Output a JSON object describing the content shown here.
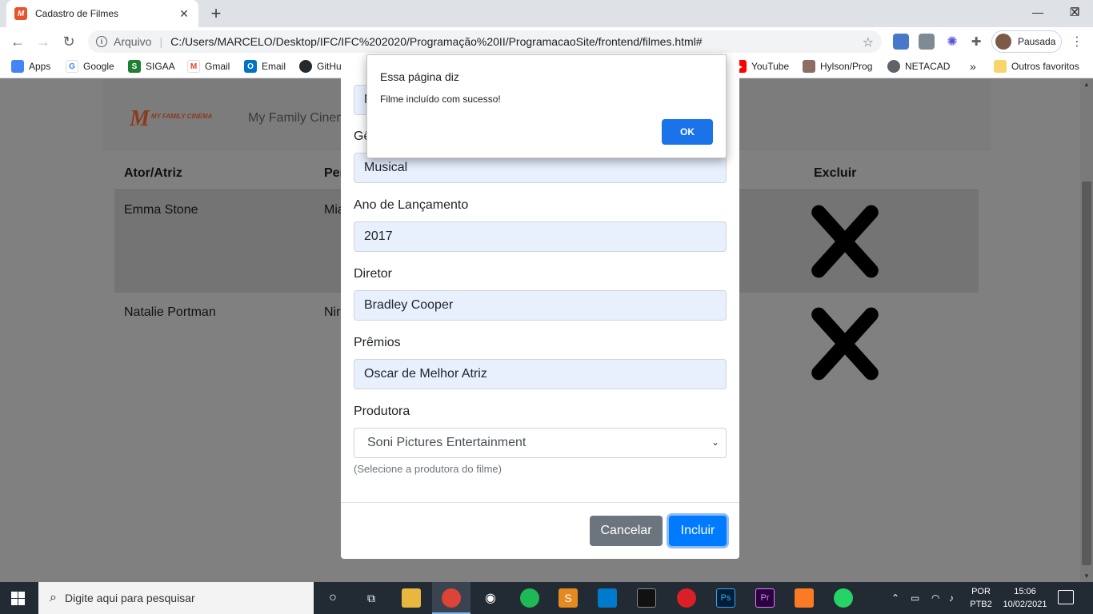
{
  "browser": {
    "tab_title": "Cadastro de Filmes",
    "tab_favicon_text": "M",
    "tab_close": "✕",
    "new_tab": "+",
    "window_controls": {
      "minimize": "—",
      "maximize": "❐",
      "close": "✕"
    },
    "nav": {
      "back": "←",
      "forward": "→",
      "reload": "↻"
    },
    "omnibox": {
      "label": "Arquivo",
      "url": "C:/Users/MARCELO/Desktop/IFC/IFC%202020/Programação%20II/ProgramacaoSite/frontend/filmes.html#"
    },
    "star": "☆",
    "profile_label": "Pausada",
    "menu": "⋮",
    "bookmarks": [
      {
        "label": "Apps",
        "icon": "apps-icon",
        "color": "#4285f4"
      },
      {
        "label": "Google",
        "icon": "google-icon",
        "color": "#4285f4"
      },
      {
        "label": "SIGAA",
        "icon": "sigaa-icon",
        "color": "#1e7e34"
      },
      {
        "label": "Gmail",
        "icon": "gmail-icon",
        "color": "#ea4335"
      },
      {
        "label": "Email",
        "icon": "outlook-icon",
        "color": "#0072c6"
      },
      {
        "label": "GitHub",
        "icon": "github-icon",
        "color": "#24292e"
      },
      {
        "label": "YouTube",
        "icon": "youtube-icon",
        "color": "#ff0000"
      },
      {
        "label": "Hylson/Prog",
        "icon": "hylson-icon",
        "color": "#8d6e63"
      },
      {
        "label": "NETACAD",
        "icon": "netacad-icon",
        "color": "#5f6368"
      }
    ],
    "bookmarks_more": "»",
    "other_bookmarks": "Outros favoritos"
  },
  "page": {
    "logo_text": "MY FAMILY CINEMA",
    "logo_mark": "M",
    "brand": "My Family Cinema",
    "table": {
      "headers": [
        "Ator/Atriz",
        "Per",
        "Excluir"
      ],
      "rows": [
        {
          "actor": "Emma Stone",
          "partial": "Mia"
        },
        {
          "actor": "Natalie Portman",
          "partial": "Nir"
        }
      ]
    }
  },
  "modal": {
    "top_input_partial": "N",
    "genre_label_partial": "Gê",
    "genre_value": "Musical",
    "year_label": "Ano de Lançamento",
    "year_value": "2017",
    "director_label": "Diretor",
    "director_value": "Bradley Cooper",
    "awards_label": "Prêmios",
    "awards_value": "Oscar de Melhor Atriz",
    "producer_label": "Produtora",
    "producer_value": "Soni Pictures Entertainment",
    "producer_help": "(Selecione a produtora do filme)",
    "cancel_label": "Cancelar",
    "submit_label": "Incluir"
  },
  "alert": {
    "title": "Essa página diz",
    "message": "Filme incluído com sucesso!",
    "ok_label": "OK"
  },
  "taskbar": {
    "search_placeholder": "Digite aqui para pesquisar",
    "lang_line1": "POR",
    "lang_line2": "PTB2",
    "time": "15:06",
    "date": "10/02/2021"
  }
}
